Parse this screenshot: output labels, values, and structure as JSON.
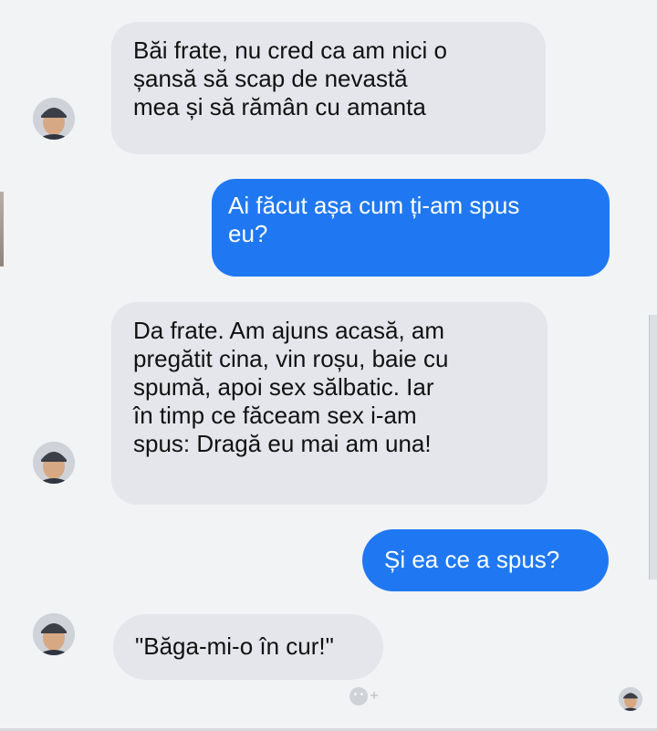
{
  "messages": [
    {
      "side": "in",
      "text": "Băi frate, nu cred ca am nici o\nșansă să scap de nevastă\nmea și să rămân cu amanta"
    },
    {
      "side": "out",
      "text": "Ai făcut așa cum ți-am spus\neu?"
    },
    {
      "side": "in",
      "text": "Da frate. Am ajuns acasă, am\npregătit cina, vin roșu, baie cu\nspumă, apoi sex sălbatic. Iar\nîn timp ce făceam sex i-am\nspus: Dragă eu mai am una!"
    },
    {
      "side": "out",
      "text": "Și ea ce a spus?"
    },
    {
      "side": "in",
      "text": "\"Băga-mi-o în cur!\""
    }
  ],
  "reaction": {
    "icon": "smiley-plus-icon",
    "plus": "+"
  },
  "colors": {
    "incoming": "#e4e6eb",
    "outgoing": "#1f78f2",
    "background": "#f2f3f5"
  }
}
